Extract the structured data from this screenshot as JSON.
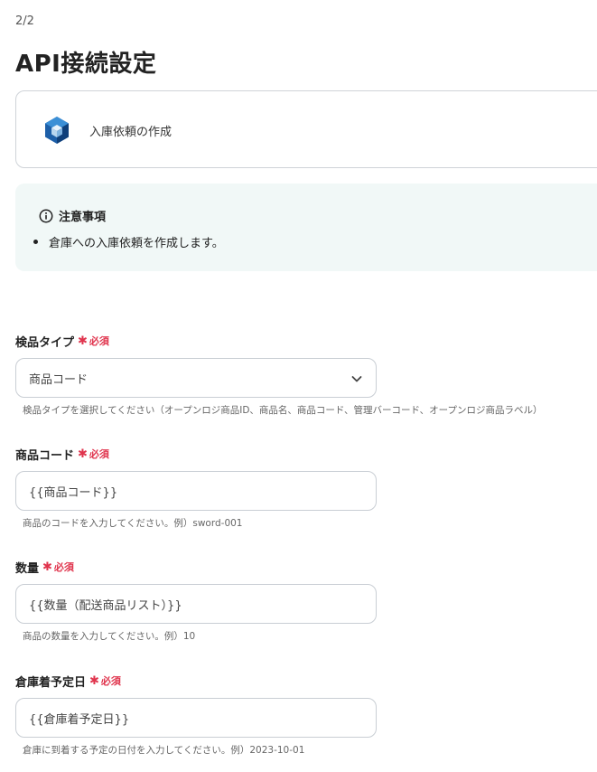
{
  "step_indicator": "2/2",
  "page_title": "API接続設定",
  "action": {
    "label": "入庫依頼の作成",
    "icon": "openlogi-cube-icon"
  },
  "notice": {
    "title": "注意事項",
    "items": [
      "倉庫への入庫依頼を作成します。"
    ]
  },
  "fields": [
    {
      "label": "検品タイプ",
      "required_mark": "✱",
      "required_text": "必須",
      "type": "select",
      "value": "商品コード",
      "help": "検品タイプを選択してください（オープンロジ商品ID、商品名、商品コード、管理バーコード、オープンロジ商品ラベル）"
    },
    {
      "label": "商品コード",
      "required_mark": "✱",
      "required_text": "必須",
      "type": "text",
      "value": "{{商品コード}}",
      "help": "商品のコードを入力してください。例）sword-001"
    },
    {
      "label": "数量",
      "required_mark": "✱",
      "required_text": "必須",
      "type": "text",
      "value": "{{数量（配送商品リスト）}}",
      "help": "商品の数量を入力してください。例）10"
    },
    {
      "label": "倉庫着予定日",
      "required_mark": "✱",
      "required_text": "必須",
      "type": "text",
      "value": "{{倉庫着予定日}}",
      "help": "倉庫に到着する予定の日付を入力してください。例）2023-10-01"
    }
  ],
  "colors": {
    "required": "#e0344d",
    "notice_bg": "#f1f8f7",
    "border": "#c9ced4"
  }
}
